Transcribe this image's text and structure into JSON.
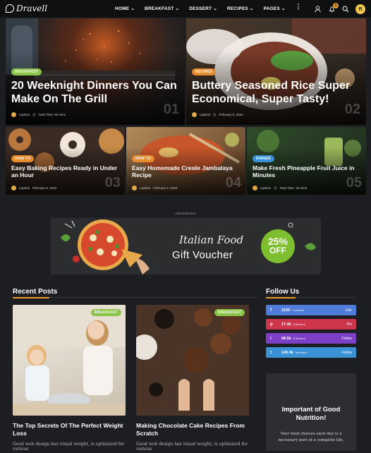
{
  "header": {
    "logo_text": "Dravell",
    "nav": [
      "HOME",
      "BREAKFAST",
      "DESSERT",
      "RECIPES",
      "PAGES"
    ],
    "notification_count": "3",
    "user_initial": "R",
    "icons": [
      "user-icon",
      "bell-icon",
      "search-icon",
      "user-avatar"
    ]
  },
  "hero": [
    {
      "tag": "BREAKFAST",
      "title": "20 Weeknight Dinners You Can Make On The Grill",
      "author": "Lipstick",
      "meta": "Total Time: 90 mins",
      "num": "01"
    },
    {
      "tag": "RECIPES",
      "title": "Buttery Seasoned Rice Super Economical, Super Tasty!",
      "author": "Lipstick",
      "meta": "February 5, 2022",
      "num": "02"
    }
  ],
  "cards": [
    {
      "tag": "HOW TO",
      "title": "Easy Baking Recipes Ready in Under an Hour",
      "author": "Lipstick",
      "meta": "February 5, 2022",
      "num": "03"
    },
    {
      "tag": "HOW TO",
      "title": "Easy Homemade Creole Jambalaya Recipe",
      "author": "Lipstick",
      "meta": "February 5, 2022",
      "num": "04"
    },
    {
      "tag": "DINNER",
      "title": "Make Fresh Pineapple Fruit Juice in Minutes",
      "author": "Lipstick",
      "meta": "Total Time: 15 mins",
      "num": "05"
    }
  ],
  "ad": {
    "label": "- Advertisement -",
    "line1": "Italian Food",
    "line2": "Gift Voucher",
    "percent": "25%",
    "off": "OFF"
  },
  "recent": {
    "heading": "Recent Posts",
    "posts": [
      {
        "tag": "BREAKFAST",
        "title": "The Top Secrets Of The Perfect Weight Loss",
        "excerpt": "Good web design has visual weight, is optimized for various"
      },
      {
        "tag": "BREAKFAST",
        "title": "Making Chocolate Cake Recipes From Scratch",
        "excerpt": "Good web design has visual weight, is optimized for various"
      }
    ]
  },
  "follow": {
    "heading": "Follow Us",
    "items": [
      {
        "icon": "f",
        "count": "2155",
        "label": "Followers",
        "action": "Like",
        "color": "#4f7bd9"
      },
      {
        "icon": "p",
        "count": "17.4k",
        "label": "Followers",
        "action": "Pin",
        "color": "#d0364b"
      },
      {
        "icon": "i",
        "count": "68.5k",
        "label": "Followers",
        "action": "Follow",
        "color": "#7e3fc8"
      },
      {
        "icon": "t",
        "count": "140.4k",
        "label": "Members",
        "action": "Follow",
        "color": "#3a91d6"
      }
    ]
  },
  "sidebar_card": {
    "title": "Important of Good Nutrition!",
    "body": "Your food choices each day is a necessary part of a complete life,"
  }
}
